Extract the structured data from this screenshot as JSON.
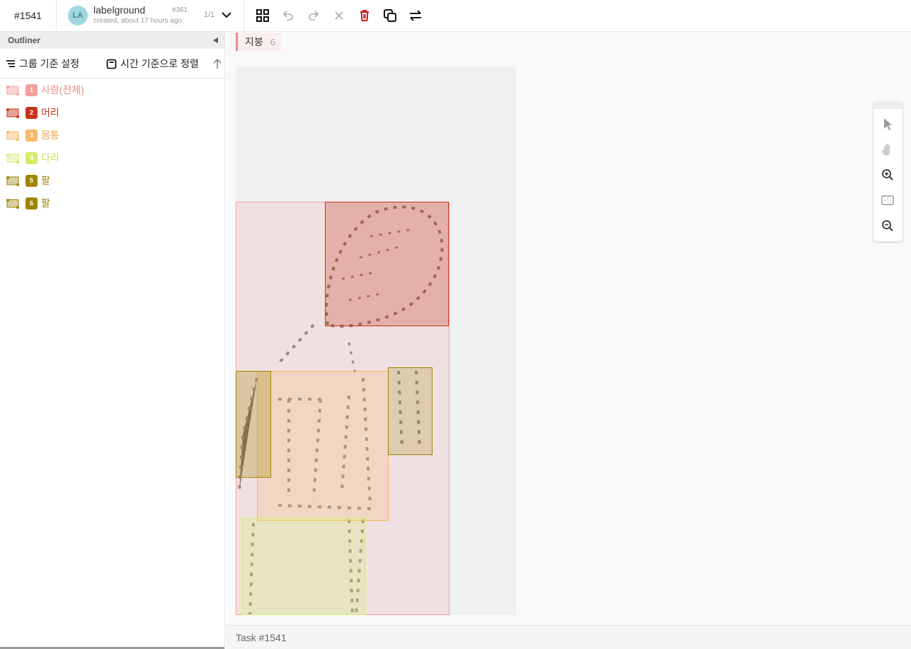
{
  "header": {
    "task_id": "#1541",
    "avatar_initials": "LA",
    "user_name": "labelground",
    "user_number": "#361",
    "created": "created, about 17 hours ago",
    "page_count": "1/1"
  },
  "toolbar": {
    "icons": [
      "grid-icon",
      "undo-icon",
      "redo-icon",
      "close-icon",
      "delete-icon",
      "copy-icon",
      "swap-icon"
    ],
    "delete_color": "#d00000"
  },
  "outliner": {
    "title": "Outliner",
    "group_label": "그룹 기준 설정",
    "sort_label": "시간 기준으로 정렬",
    "items": [
      {
        "num": "1",
        "label": "사람(전체)",
        "color": "#f4a09c",
        "text_color": "#f08a86"
      },
      {
        "num": "2",
        "label": "머리",
        "color": "#c8361a",
        "text_color": "#c8361a"
      },
      {
        "num": "3",
        "label": "몸통",
        "color": "#f7b96a",
        "text_color": "#f0a54a"
      },
      {
        "num": "4",
        "label": "다리",
        "color": "#d4ec6a",
        "text_color": "#c9e24c"
      },
      {
        "num": "5",
        "label": "팔",
        "color": "#a08600",
        "text_color": "#9a8200"
      },
      {
        "num": "6",
        "label": "팔",
        "color": "#a08600",
        "text_color": "#9a8200"
      }
    ]
  },
  "workspace": {
    "class_tag_name": "지붕",
    "class_tag_count": "6"
  },
  "tools": [
    "pointer-icon",
    "hand-icon",
    "zoom-in-icon",
    "fit-icon",
    "zoom-out-icon"
  ],
  "footer": {
    "task_label": "Task #1541"
  }
}
